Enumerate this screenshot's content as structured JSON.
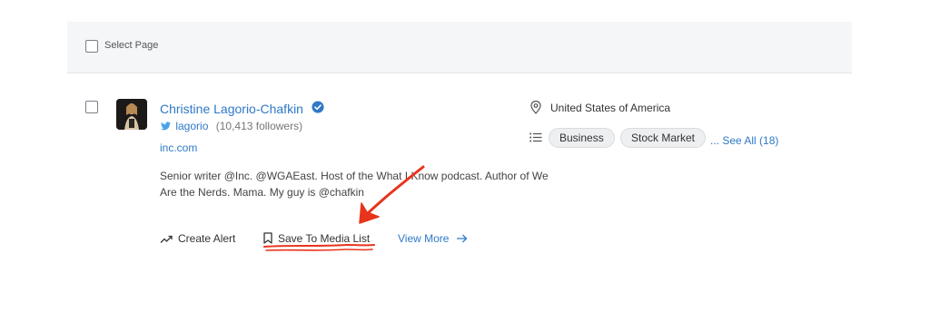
{
  "header": {
    "select_page_label": "Select Page"
  },
  "result": {
    "name": "Christine Lagorio-Chafkin",
    "twitter_handle": "lagorio",
    "twitter_followers": "(10,413 followers)",
    "domain": "inc.com",
    "bio": "Senior writer @Inc. @WGAEast. Host of the What I Know podcast. Author of We Are the Nerds. Mama. My guy is @chafkin",
    "location": "United States of America",
    "topics": [
      "Business",
      "Stock Market"
    ],
    "see_all_label": "... See All (18)"
  },
  "actions": {
    "create_alert": "Create Alert",
    "save_to_media_list": "Save To Media List",
    "view_more": "View More"
  },
  "colors": {
    "link": "#2f79c7",
    "annotation": "#e8341c",
    "header_bg": "#f5f6f8"
  },
  "icons": [
    "checkbox",
    "verified-icon",
    "twitter-icon",
    "location-pin-icon",
    "list-icon",
    "trending-icon",
    "bookmark-icon",
    "arrow-right-icon"
  ]
}
